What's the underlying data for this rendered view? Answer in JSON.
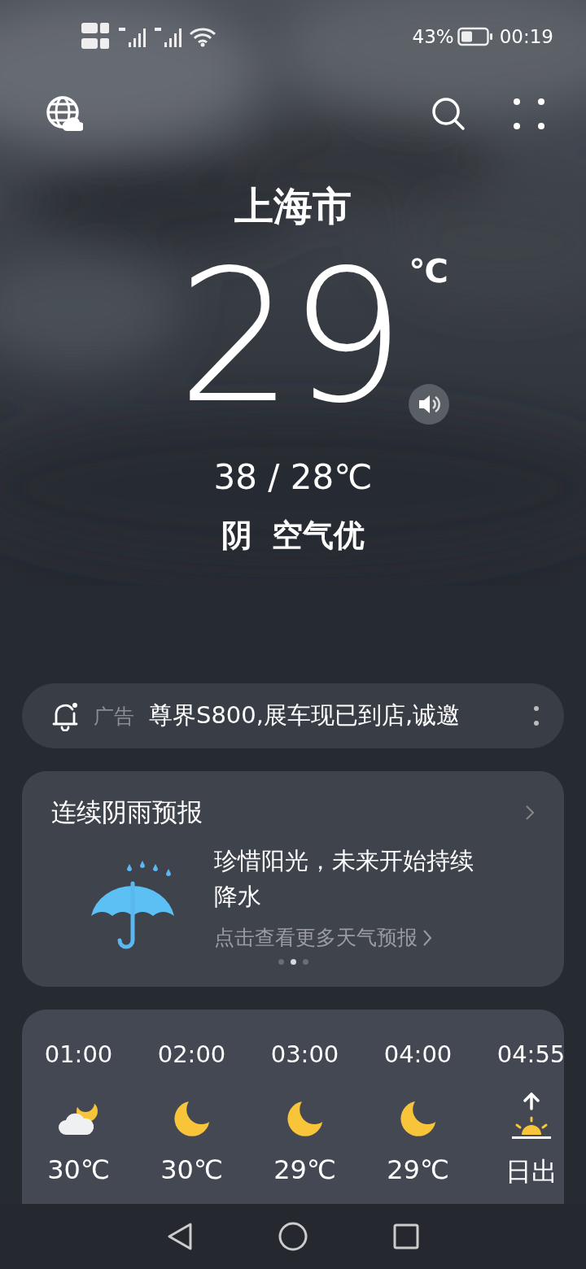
{
  "status_bar": {
    "battery": "43%",
    "time": "00:19"
  },
  "city": "上海市",
  "temperature": "29",
  "unit": "℃",
  "range": "38 / 28℃",
  "condition": "阴",
  "air_quality": "空气优",
  "ad": {
    "label": "广告",
    "text": "尊界S800,展车现已到店,诚邀"
  },
  "forecast_card": {
    "title": "连续阴雨预报",
    "message": "珍惜阳光，未来开始持续降水",
    "link": "点击查看更多天气预报",
    "pages": [
      {
        "selected": false
      },
      {
        "selected": true
      },
      {
        "selected": false
      }
    ]
  },
  "hourly": [
    {
      "time": "01:00",
      "kind": "cloudy-night",
      "temp": "30℃"
    },
    {
      "time": "02:00",
      "kind": "moon",
      "temp": "30℃"
    },
    {
      "time": "03:00",
      "kind": "moon",
      "temp": "29℃"
    },
    {
      "time": "04:00",
      "kind": "moon",
      "temp": "29℃"
    },
    {
      "time": "04:55",
      "kind": "sunrise",
      "temp": "日出"
    }
  ]
}
